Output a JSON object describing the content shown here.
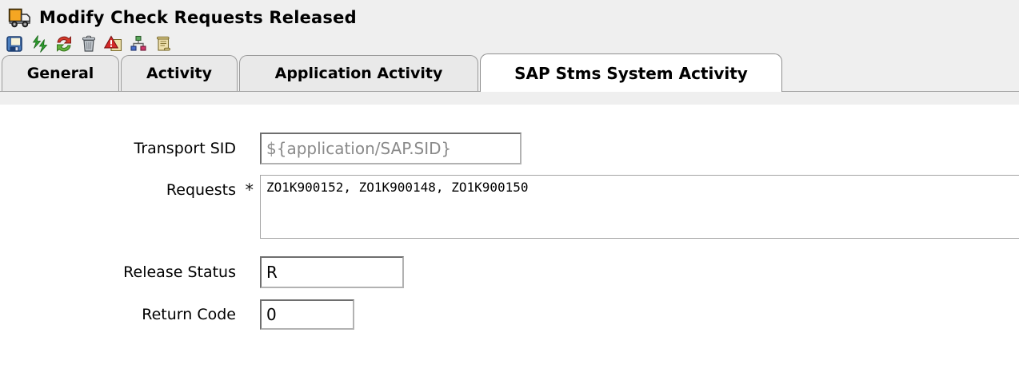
{
  "window": {
    "title": "Modify Check Requests Released",
    "title_icon": "truck-icon"
  },
  "toolbar": {
    "buttons": [
      {
        "name": "save",
        "icon": "save-icon"
      },
      {
        "name": "execute",
        "icon": "green-double-arrows-icon"
      },
      {
        "name": "refresh",
        "icon": "red-green-circular-arrows-icon"
      },
      {
        "name": "delete",
        "icon": "trash-icon"
      },
      {
        "name": "validate",
        "icon": "warning-scroll-icon"
      },
      {
        "name": "dependencies",
        "icon": "node-tree-icon"
      },
      {
        "name": "script",
        "icon": "scroll-icon"
      }
    ]
  },
  "tabs": [
    {
      "label": "General",
      "active": false
    },
    {
      "label": "Activity",
      "active": false
    },
    {
      "label": "Application Activity",
      "active": false
    },
    {
      "label": "SAP Stms System Activity",
      "active": true
    }
  ],
  "form": {
    "required_marker": "*",
    "fields": {
      "transport_sid": {
        "label": "Transport SID",
        "value": "${application/SAP.SID}",
        "required": false
      },
      "requests": {
        "label": "Requests",
        "value": "ZO1K900152, ZO1K900148, ZO1K900150",
        "required": true
      },
      "release_status": {
        "label": "Release Status",
        "value": "R",
        "required": false
      },
      "return_code": {
        "label": "Return Code",
        "value": "0",
        "required": false
      }
    }
  },
  "colors": {
    "page_top_background": "#efefef",
    "content_background": "#ffffff",
    "tab_inactive_background": "#e9e9e9",
    "tab_active_background": "#ffffff",
    "tab_border": "#9b9b9b",
    "input_border_dark": "#6e6e6e",
    "input_border_light": "#b2b2b2",
    "placeholder_text": "#8a8a8a"
  }
}
